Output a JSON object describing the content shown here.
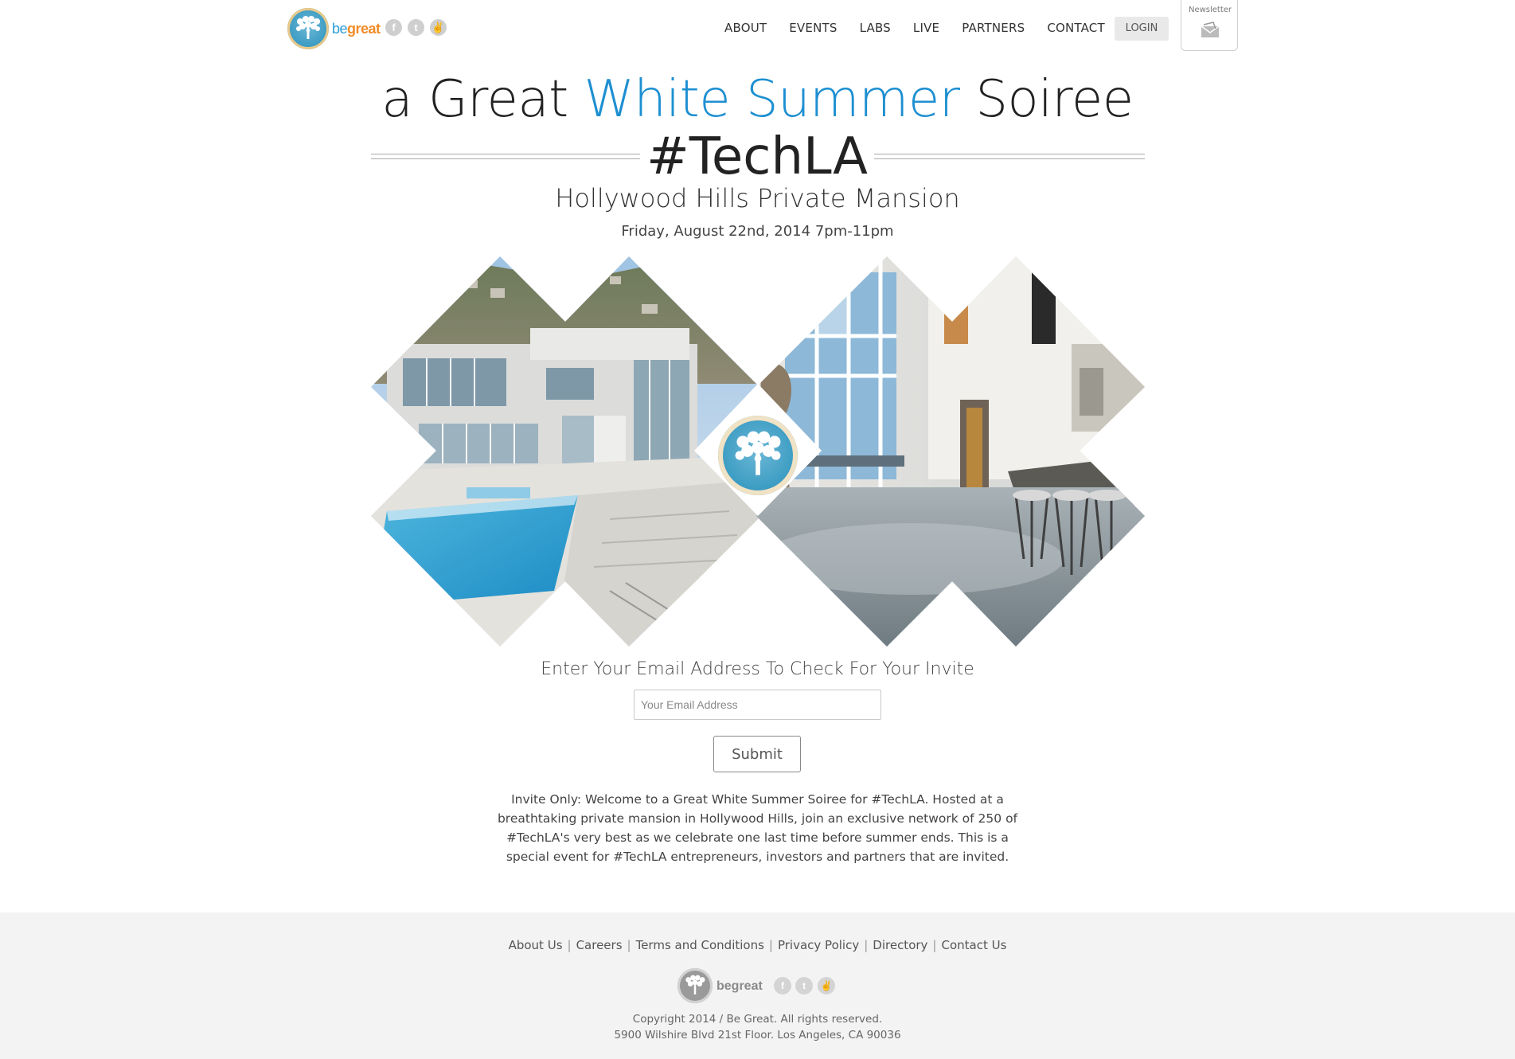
{
  "header": {
    "brand_be": "be",
    "brand_great": "great",
    "social": [
      {
        "icon": "facebook-icon",
        "glyph": "f"
      },
      {
        "icon": "twitter-icon",
        "glyph": "t"
      },
      {
        "icon": "peace-icon",
        "glyph": "✌"
      }
    ],
    "nav": [
      "ABOUT",
      "EVENTS",
      "LABS",
      "LIVE",
      "PARTNERS",
      "CONTACT"
    ],
    "login": "LOGIN",
    "newsletter": "Newsletter"
  },
  "hero": {
    "title_pre": "a Great ",
    "title_accent": "White Summer",
    "title_post": " Soiree",
    "title_line2": "#TechLA",
    "subtitle": "Hollywood Hills Private Mansion",
    "date": "Friday, August 22nd, 2014 7pm-11pm",
    "accent_color": "#1d8fd1"
  },
  "signup": {
    "prompt": "Enter Your Email Address To Check For Your Invite",
    "email_placeholder": "Your Email Address",
    "submit": "Submit",
    "description": "Invite Only: Welcome to a Great White Summer Soiree for #TechLA. Hosted at a breathtaking private mansion in Hollywood Hills, join an exclusive network of 250 of #TechLA's very best as we celebrate one last time before summer ends. This is a special event for #TechLA entrepreneurs, investors and partners that are invited."
  },
  "footer": {
    "links": [
      "About Us",
      "Careers",
      "Terms and Conditions",
      "Privacy Policy",
      "Directory",
      "Contact Us"
    ],
    "brand": "begreat",
    "copyright": "Copyright 2014 / Be Great. All rights reserved.",
    "address": "5900 Wilshire Blvd 21st Floor. Los Angeles, CA 90036"
  }
}
